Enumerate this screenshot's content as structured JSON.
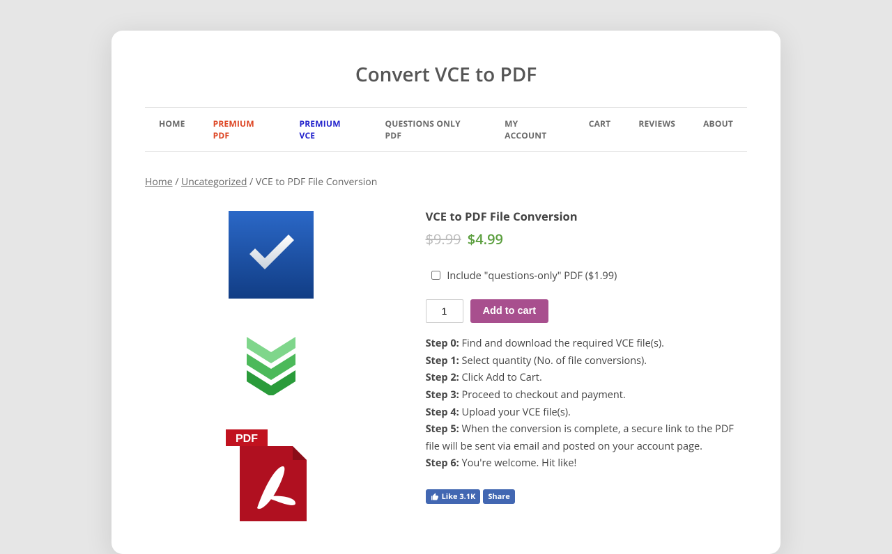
{
  "site": {
    "title": "Convert VCE to PDF"
  },
  "nav": {
    "home": "HOME",
    "premium_pdf": "PREMIUM PDF",
    "premium_vce": "PREMIUM VCE",
    "questions_only_pdf": "QUESTIONS ONLY PDF",
    "my_account": "MY ACCOUNT",
    "cart": "CART",
    "reviews": "REVIEWS",
    "about": "ABOUT"
  },
  "breadcrumb": {
    "home": "Home",
    "category": "Uncategorized",
    "current": "VCE to PDF File Conversion"
  },
  "product": {
    "title": "VCE to PDF File Conversion",
    "price_old": "$9.99",
    "price_new": "$4.99",
    "addon_label": "Include \"questions-only\" PDF ($1.99)",
    "quantity": "1",
    "add_to_cart": "Add to cart"
  },
  "steps": [
    {
      "label": "Step 0:",
      "text": " Find and download the required VCE file(s)."
    },
    {
      "label": "Step 1:",
      "text": " Select quantity (No. of file conversions)."
    },
    {
      "label": "Step 2:",
      "text": " Click Add to Cart."
    },
    {
      "label": "Step 3:",
      "text": " Proceed to checkout and payment."
    },
    {
      "label": "Step 4:",
      "text": " Upload your VCE file(s)."
    },
    {
      "label": "Step 5:",
      "text": " When the conversion is complete, a secure link to the PDF file will be sent via email and posted on your account page."
    },
    {
      "label": "Step 6:",
      "text": " You're welcome. Hit like!"
    }
  ],
  "social": {
    "like_label": "Like",
    "like_count": "3.1K",
    "share_label": "Share"
  }
}
